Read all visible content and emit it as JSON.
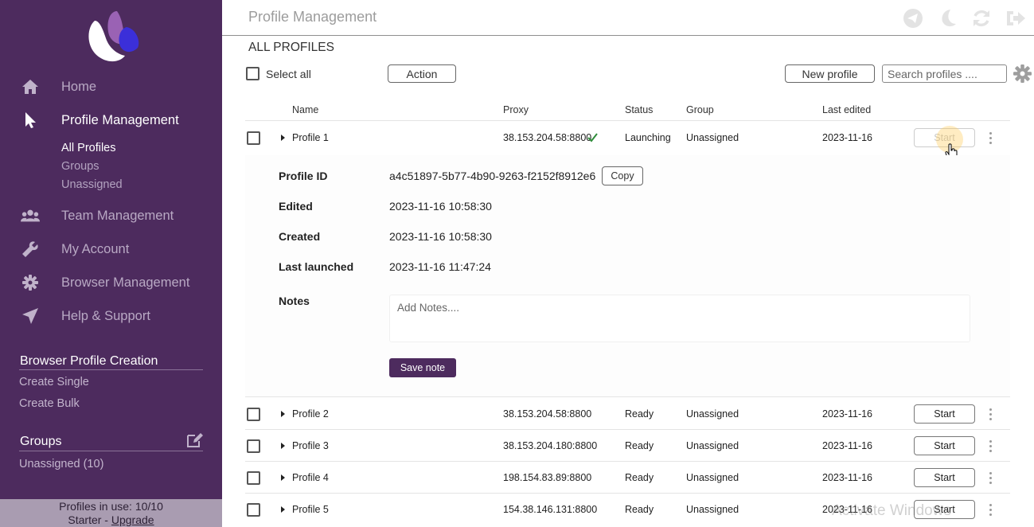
{
  "sidebar": {
    "nav": [
      {
        "label": "Home",
        "icon": "home-icon"
      },
      {
        "label": "Profile Management",
        "icon": "cursor-icon",
        "active": true
      },
      {
        "label": "Team Management",
        "icon": "users-icon"
      },
      {
        "label": "My Account",
        "icon": "wrench-icon"
      },
      {
        "label": "Browser Management",
        "icon": "gear-icon"
      },
      {
        "label": "Help & Support",
        "icon": "rocket-icon"
      }
    ],
    "profile_sub": [
      "All Profiles",
      "Groups",
      "Unassigned"
    ],
    "creation": {
      "title": "Browser Profile Creation",
      "links": [
        "Create Single",
        "Create Bulk"
      ]
    },
    "groups": {
      "title": "Groups",
      "items": [
        "Unassigned (10)"
      ]
    },
    "footer": {
      "usage": "Profiles in use:  10/10",
      "plan": "Starter - ",
      "upgrade": "Upgrade"
    },
    "colors": {
      "background": "#4d2b5e",
      "footer": "#a99cb1"
    }
  },
  "header": {
    "title": "Profile Management",
    "icons": [
      "telegram-icon",
      "moon-icon",
      "refresh-icon",
      "logout-icon"
    ]
  },
  "main": {
    "section_title": "ALL PROFILES",
    "select_all": "Select all",
    "action_label": "Action",
    "new_profile_label": "New profile",
    "search_placeholder": "Search profiles ....",
    "columns": [
      "Name",
      "Proxy",
      "Status",
      "Group",
      "Last edited"
    ],
    "rows": [
      {
        "name": "Profile 1",
        "proxy": "38.153.204.58:8800",
        "status": "Launching",
        "group": "Unassigned",
        "edited": "2023-11-16",
        "start": "Start"
      },
      {
        "name": "Profile 2",
        "proxy": "38.153.204.58:8800",
        "status": "Ready",
        "group": "Unassigned",
        "edited": "2023-11-16",
        "start": "Start"
      },
      {
        "name": "Profile 3",
        "proxy": "38.153.204.180:8800",
        "status": "Ready",
        "group": "Unassigned",
        "edited": "2023-11-16",
        "start": "Start"
      },
      {
        "name": "Profile 4",
        "proxy": "198.154.83.89:8800",
        "status": "Ready",
        "group": "Unassigned",
        "edited": "2023-11-16",
        "start": "Start"
      },
      {
        "name": "Profile 5",
        "proxy": "154.38.146.131:8800",
        "status": "Ready",
        "group": "Unassigned",
        "edited": "2023-11-16",
        "start": "Start"
      }
    ],
    "detail": {
      "profile_id_label": "Profile ID",
      "profile_id": "a4c51897-5b77-4b90-9263-f2152f8912e6",
      "copy_label": "Copy",
      "edited_label": "Edited",
      "edited": "2023-11-16 10:58:30",
      "created_label": "Created",
      "created": "2023-11-16 10:58:30",
      "launched_label": "Last launched",
      "launched": "2023-11-16 11:47:24",
      "notes_label": "Notes",
      "notes_placeholder": "Add Notes....",
      "save_label": "Save note"
    },
    "colors": {
      "accent": "#4d2b5e",
      "proxy_ok": "#2e8b3a"
    }
  },
  "overlay": {
    "watermark": "Activate Windows"
  }
}
